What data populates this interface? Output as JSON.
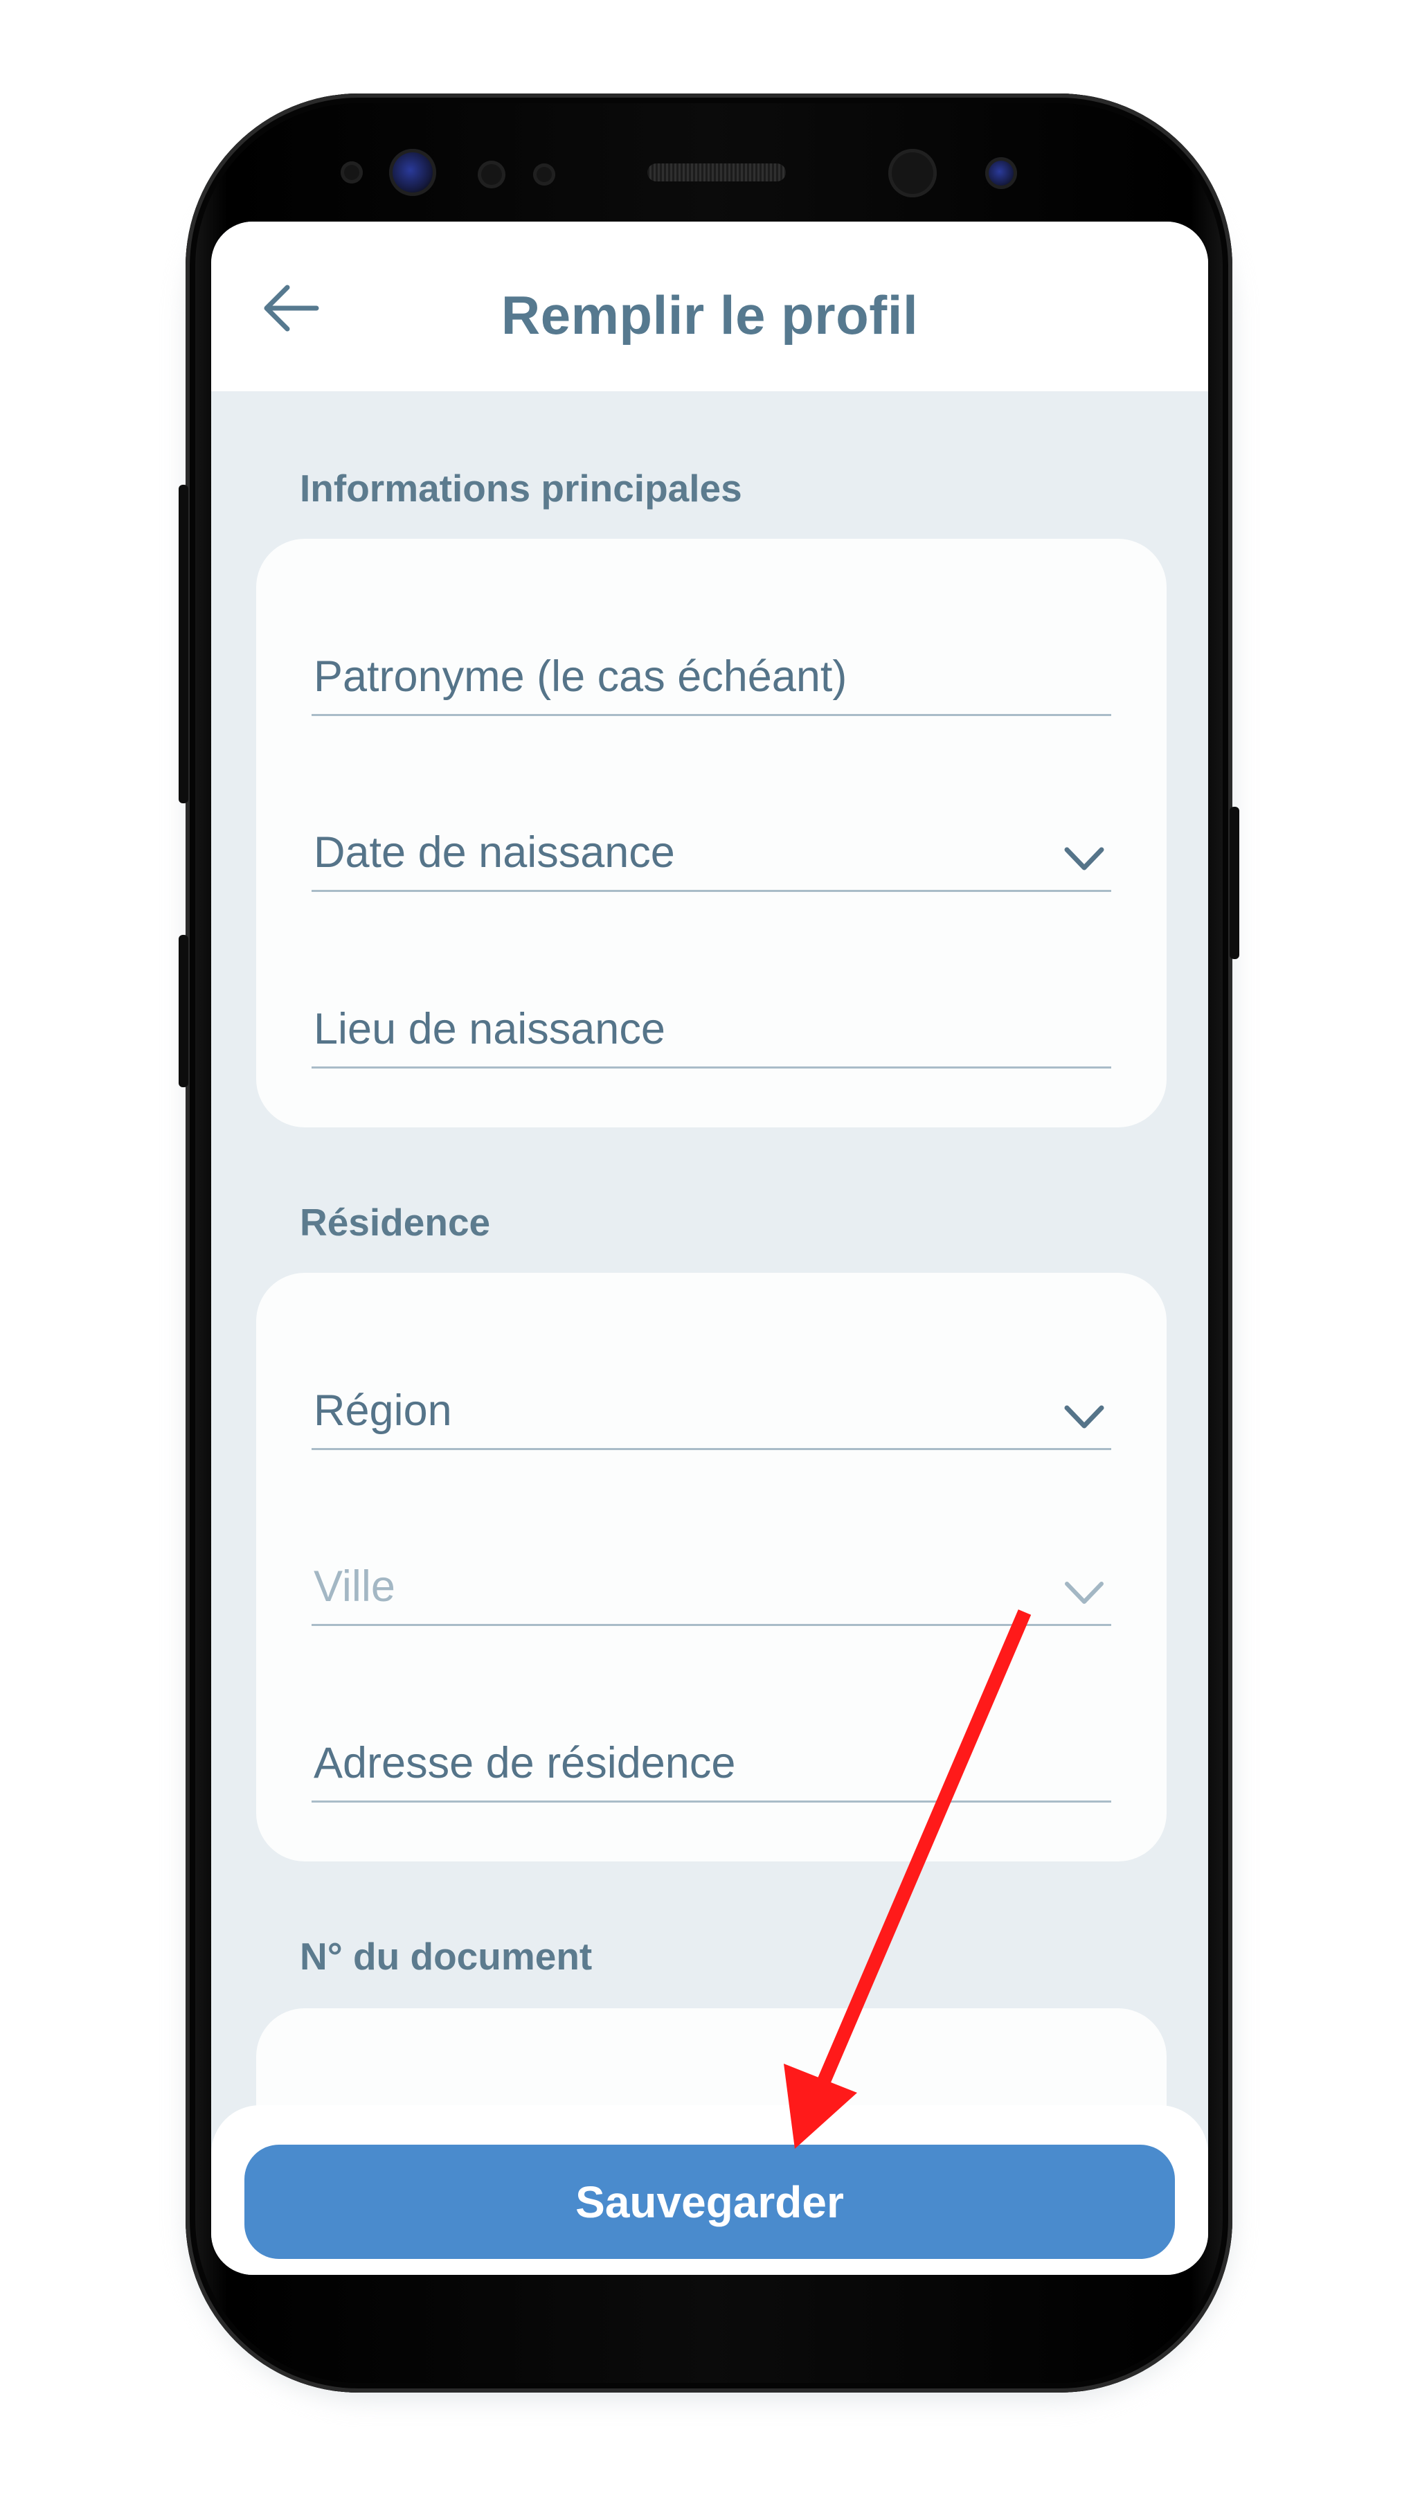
{
  "header": {
    "title": "Remplir le profil",
    "back_icon": "arrow-left-icon"
  },
  "sections": [
    {
      "label": "Informations principales",
      "fields": [
        {
          "label": "Patronyme (le cas échéant)",
          "type": "text"
        },
        {
          "label": "Date de naissance",
          "type": "dropdown"
        },
        {
          "label": "Lieu de naissance",
          "type": "text"
        }
      ]
    },
    {
      "label": "Résidence",
      "fields": [
        {
          "label": "Région",
          "type": "dropdown"
        },
        {
          "label": "Ville",
          "type": "dropdown",
          "state": "disabled"
        },
        {
          "label": "Adresse de résidence",
          "type": "text"
        }
      ]
    },
    {
      "label": "N° du document",
      "fields": []
    }
  ],
  "footer": {
    "save_label": "Sauvegarder"
  },
  "colors": {
    "accent": "#4a8bcd",
    "title": "#56798f",
    "background": "#e8eef2",
    "annotation": "#ff1a1a"
  }
}
